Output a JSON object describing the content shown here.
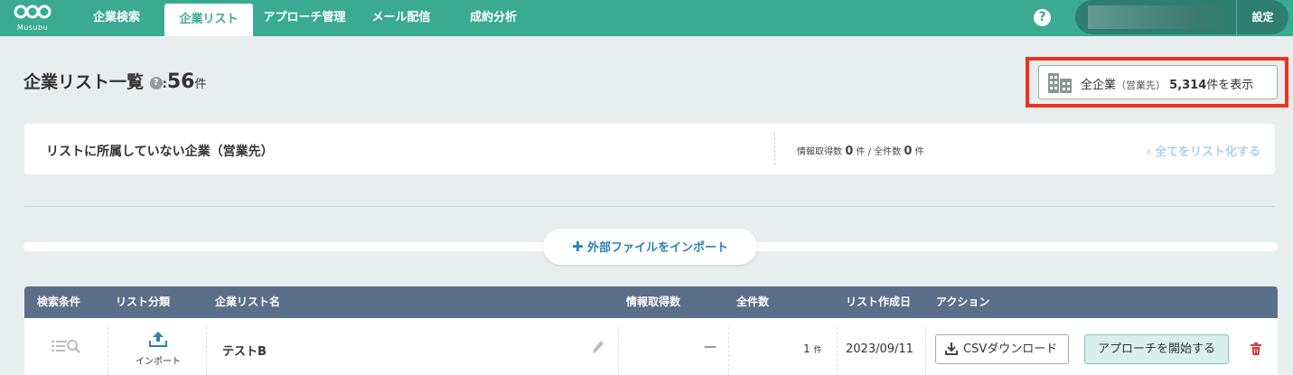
{
  "brand": {
    "logo_text": "Musubu",
    "accent": "#3aaa93"
  },
  "nav": {
    "items": [
      {
        "label": "企業検索"
      },
      {
        "label": "企業リスト",
        "active": true
      },
      {
        "label": "アプローチ管理"
      },
      {
        "label": "メール配信"
      },
      {
        "label": "成約分析"
      }
    ],
    "help_label": "?",
    "settings_label": "設定"
  },
  "header": {
    "title": "企業リスト一覧",
    "help_label": "?",
    "colon": ":",
    "count": "56",
    "unit": "件",
    "all_button": {
      "prefix": "全企業",
      "paren": "（営業先）",
      "count": "5,314",
      "suffix": "件を表示"
    }
  },
  "unassigned": {
    "title": "リストに所属していない企業（営業先）",
    "info_label": "情報取得数",
    "info_value": "0",
    "info_unit": "件",
    "slash": "/",
    "total_label": "全件数",
    "total_value": "0",
    "total_unit": "件",
    "link_label": "全てをリスト化する"
  },
  "import_button": {
    "plus": "✚",
    "label": "外部ファイルをインポート"
  },
  "table": {
    "headers": [
      "検索条件",
      "リスト分類",
      "企業リスト名",
      "情報取得数",
      "全件数",
      "リスト作成日",
      "アクション"
    ],
    "rows": [
      {
        "category": "インポート",
        "name": "テストB",
        "info_count": "—",
        "total": "1",
        "total_unit": "件",
        "created": "2023/09/11",
        "csv_label": "CSVダウンロード",
        "approach_label": "アプローチを開始する"
      }
    ]
  },
  "highlight_color": "#f03020"
}
